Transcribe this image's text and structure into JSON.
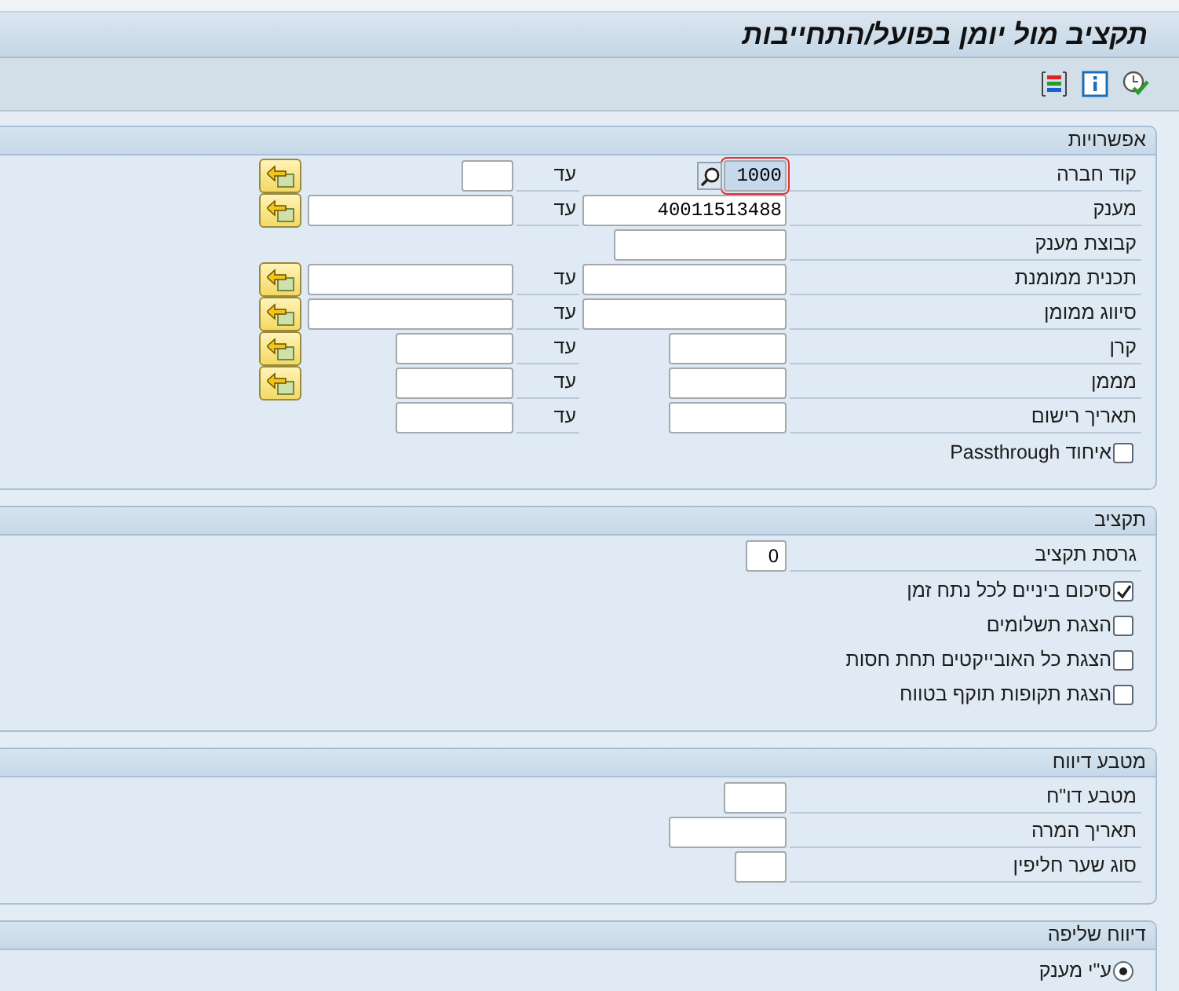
{
  "window": {
    "title": "תקציב מול יומן בפועל/התחייבות"
  },
  "toolbar": [
    {
      "kind": "execute"
    },
    {
      "kind": "info"
    },
    {
      "kind": "layout"
    }
  ],
  "sections": [
    {
      "title": "אפשרויות",
      "rows": [
        {
          "kind": "range",
          "label": "קוד חברה",
          "from": {
            "value": "1000",
            "focused": true
          },
          "to_label": "עד",
          "multi_button": true
        },
        {
          "kind": "range",
          "label": "מענק",
          "from": {
            "value": "40011513488",
            "focused": false
          },
          "to_label": "עד",
          "multi_button": true
        },
        {
          "kind": "single",
          "label": "קבוצת מענק",
          "from": {
            "focused": false
          }
        },
        {
          "kind": "range",
          "label": "תכנית ממומנת",
          "from": {
            "focused": false
          },
          "to_label": "עד",
          "multi_button": true
        },
        {
          "kind": "range",
          "label": "סיווג ממומן",
          "from": {
            "focused": false
          },
          "to_label": "עד",
          "multi_button": true
        },
        {
          "kind": "range",
          "label": "קרן",
          "from": {
            "focused": false
          },
          "to_label": "עד",
          "multi_button": true
        },
        {
          "kind": "range",
          "label": "מממן",
          "from": {
            "focused": false
          },
          "to_label": "עד",
          "multi_button": true
        },
        {
          "kind": "range",
          "label": "תאריך רישום",
          "from": {
            "focused": false
          },
          "to_label": "עד",
          "multi_button": false
        },
        {
          "kind": "checkbox",
          "label": "איחוד Passthrough",
          "checked": false
        }
      ]
    },
    {
      "title": "תקציב",
      "rows": [
        {
          "kind": "single",
          "label": "גרסת תקציב",
          "from": {
            "value": "0",
            "focused": false
          }
        },
        {
          "kind": "checkbox",
          "label": "סיכום ביניים לכל נתח זמן",
          "checked": true
        },
        {
          "kind": "checkbox",
          "label": "הצגת תשלומים",
          "checked": false
        },
        {
          "kind": "checkbox",
          "label": "הצגת כל האובייקטים תחת חסות",
          "checked": false
        },
        {
          "kind": "checkbox",
          "label": "הצגת תקופות תוקף בטווח",
          "checked": false
        }
      ]
    },
    {
      "title": "מטבע דיווח",
      "rows": [
        {
          "kind": "single",
          "label": "מטבע דו\"ח",
          "from": {
            "focused": false
          }
        },
        {
          "kind": "single",
          "label": "תאריך המרה",
          "from": {
            "focused": false
          }
        },
        {
          "kind": "single",
          "label": "סוג שער חליפין",
          "from": {
            "focused": false
          }
        }
      ]
    },
    {
      "title": "דיווח שליפה",
      "rows": [
        {
          "kind": "radio",
          "label": "ע\"י מענק",
          "selected": true
        }
      ]
    }
  ]
}
